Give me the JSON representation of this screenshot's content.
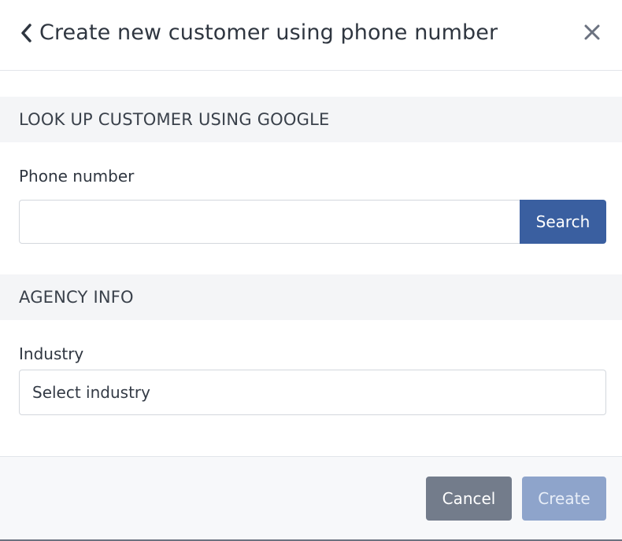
{
  "header": {
    "title": "Create new customer using phone number",
    "back_icon": "chevron-left-icon",
    "close_icon": "close-icon"
  },
  "lookup_section": {
    "heading": "LOOK UP CUSTOMER USING GOOGLE",
    "phone_label": "Phone number",
    "phone_value": "",
    "phone_placeholder": "",
    "search_label": "Search"
  },
  "agency_section": {
    "heading": "AGENCY INFO",
    "industry_label": "Industry",
    "industry_selected": "Select industry"
  },
  "footer": {
    "cancel_label": "Cancel",
    "create_label": "Create",
    "create_enabled": false
  },
  "colors": {
    "primary": "#3a5fa0",
    "primary_disabled": "#8ea4cb",
    "secondary": "#737c8b",
    "section_background": "#f4f5f7"
  }
}
